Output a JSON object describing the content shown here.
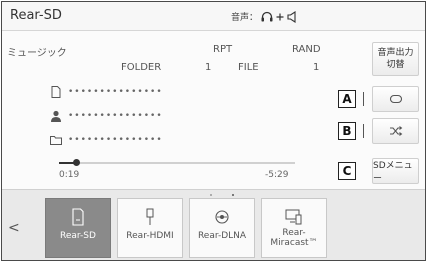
{
  "header": {
    "title": "Rear-SD",
    "audio_label": "音声："
  },
  "info": {
    "source_label": "ミュージック",
    "rpt_label": "RPT",
    "rand_label": "RAND",
    "folder_label": "FOLDER",
    "folder_value": "1",
    "file_label": "FILE",
    "file_value": "1"
  },
  "tracks": {
    "title": "•••••••••••••••",
    "artist": "•••••••••••••••",
    "album": "•••••••••••••••"
  },
  "playback": {
    "elapsed": "0:19",
    "remaining": "-5:29",
    "progress": 0.07
  },
  "side": {
    "audio_output_line1": "音声出力",
    "audio_output_line2": "切替",
    "badge_a": "A",
    "badge_b": "B",
    "badge_c": "C",
    "sd_menu": "SDメニュー"
  },
  "sources": {
    "back": "<",
    "items": [
      {
        "label": "Rear-SD",
        "icon": "sd-card-icon",
        "active": true
      },
      {
        "label": "Rear-HDMI",
        "icon": "hdmi-plug-icon",
        "active": false
      },
      {
        "label": "Rear-DLNA",
        "icon": "dlna-icon",
        "active": false
      },
      {
        "label_line1": "Rear-",
        "label_line2": "Miracast™",
        "icon": "miracast-icon",
        "active": false
      }
    ]
  }
}
